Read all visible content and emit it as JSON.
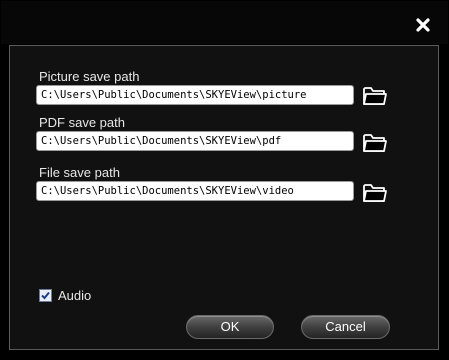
{
  "dialog": {
    "close_icon": "close-icon"
  },
  "paths": [
    {
      "label": "Picture save path",
      "value": "C:\\Users\\Public\\Documents\\SKYEView\\picture",
      "icon": "folder-icon"
    },
    {
      "label": "PDF save path",
      "value": "C:\\Users\\Public\\Documents\\SKYEView\\pdf",
      "icon": "folder-icon"
    },
    {
      "label": "File save path",
      "value": "C:\\Users\\Public\\Documents\\SKYEView\\video",
      "icon": "folder-icon"
    }
  ],
  "audio": {
    "label": "Audio",
    "checked": true
  },
  "buttons": {
    "ok": "OK",
    "cancel": "Cancel"
  },
  "colors": {
    "background": "#000000",
    "panel": "#111111",
    "panel_border": "#5a5a5a",
    "text": "#e8e8e8",
    "checkbox_check": "#1c3f8c"
  }
}
